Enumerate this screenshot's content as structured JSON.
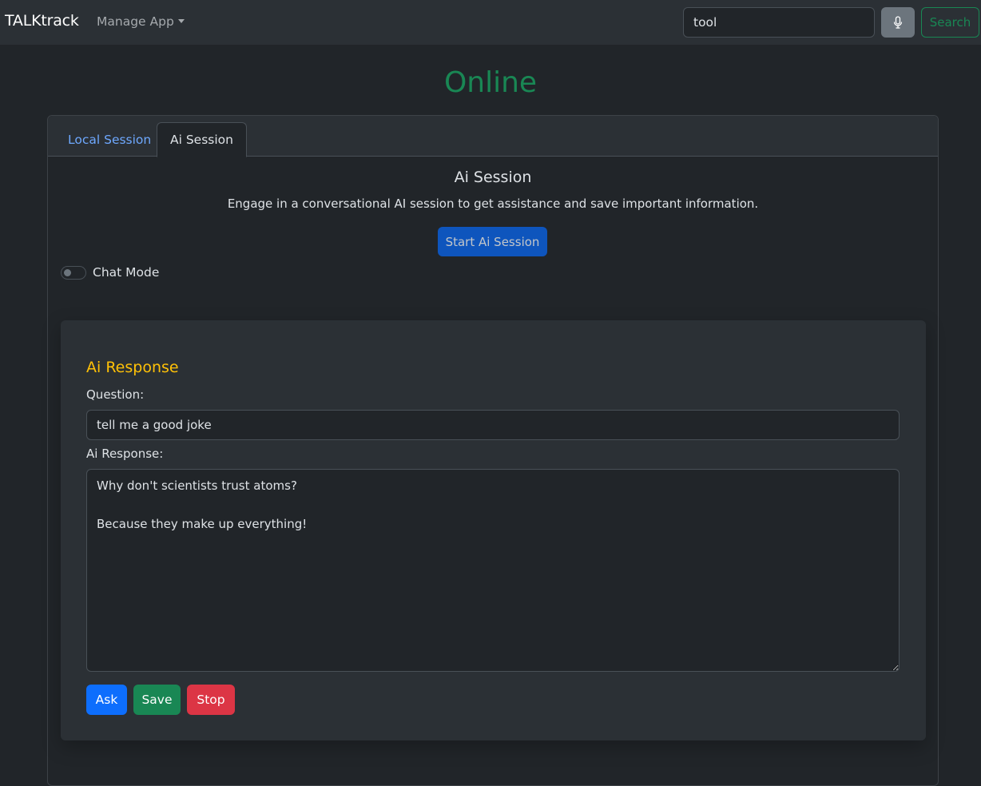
{
  "navbar": {
    "brand": "TALKtrack",
    "manage_label": "Manage App",
    "search_value": "tool",
    "search_button": "Search",
    "mic_icon": "microphone-icon"
  },
  "status": "Online",
  "tabs": [
    {
      "label": "Local Session",
      "active": false
    },
    {
      "label": "Ai Session",
      "active": true
    }
  ],
  "session": {
    "title": "Ai Session",
    "description": "Engage in a conversational AI session to get assistance and save important information.",
    "start_button": "Start Ai Session",
    "chat_mode_label": "Chat Mode",
    "chat_mode_on": false
  },
  "response_panel": {
    "title": "Ai Response",
    "question_label": "Question:",
    "question_value": "tell me a good joke",
    "response_label": "Ai Response:",
    "response_value": "Why don't scientists trust atoms?\n\nBecause they make up everything!",
    "buttons": {
      "ask": "Ask",
      "save": "Save",
      "stop": "Stop"
    }
  },
  "colors": {
    "online": "#198754",
    "panel_title": "#ffc107",
    "ask": "#0d6efd",
    "save": "#198754",
    "stop": "#dc3545"
  }
}
